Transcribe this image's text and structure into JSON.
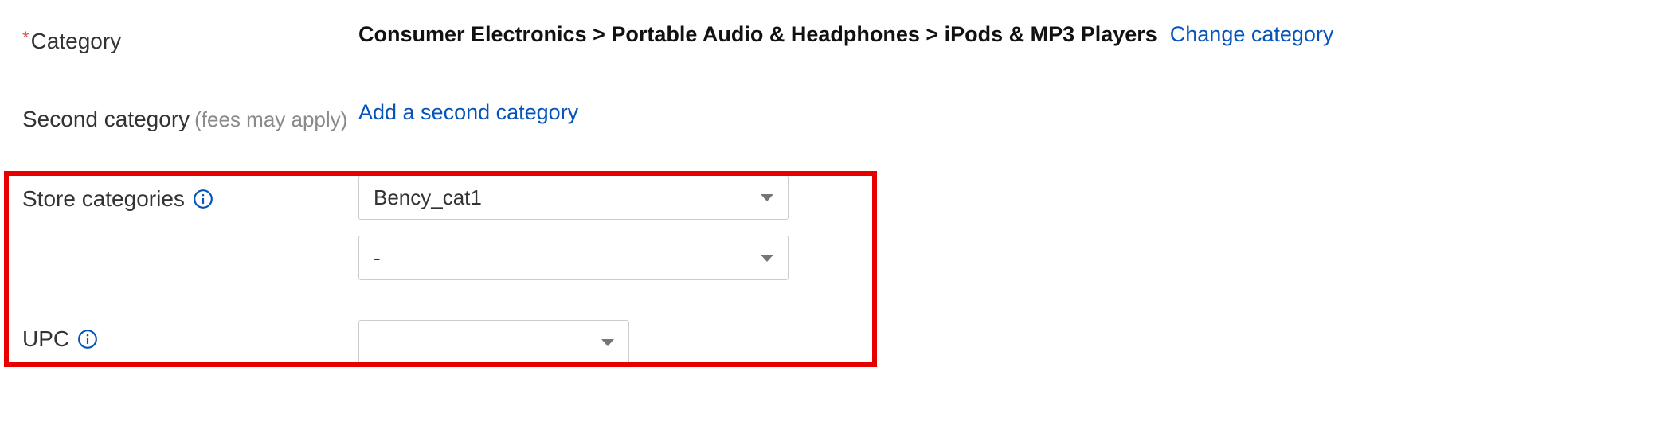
{
  "category": {
    "label": "Category",
    "required_mark": "*",
    "path": "Consumer Electronics > Portable Audio & Headphones > iPods & MP3 Players",
    "change_link": "Change category"
  },
  "second_category": {
    "label": "Second category",
    "note": "(fees may apply)",
    "add_link": "Add a second category"
  },
  "store_categories": {
    "label": "Store categories",
    "select1": "Bency_cat1",
    "select2": "-"
  },
  "upc": {
    "label": "UPC",
    "select": ""
  }
}
